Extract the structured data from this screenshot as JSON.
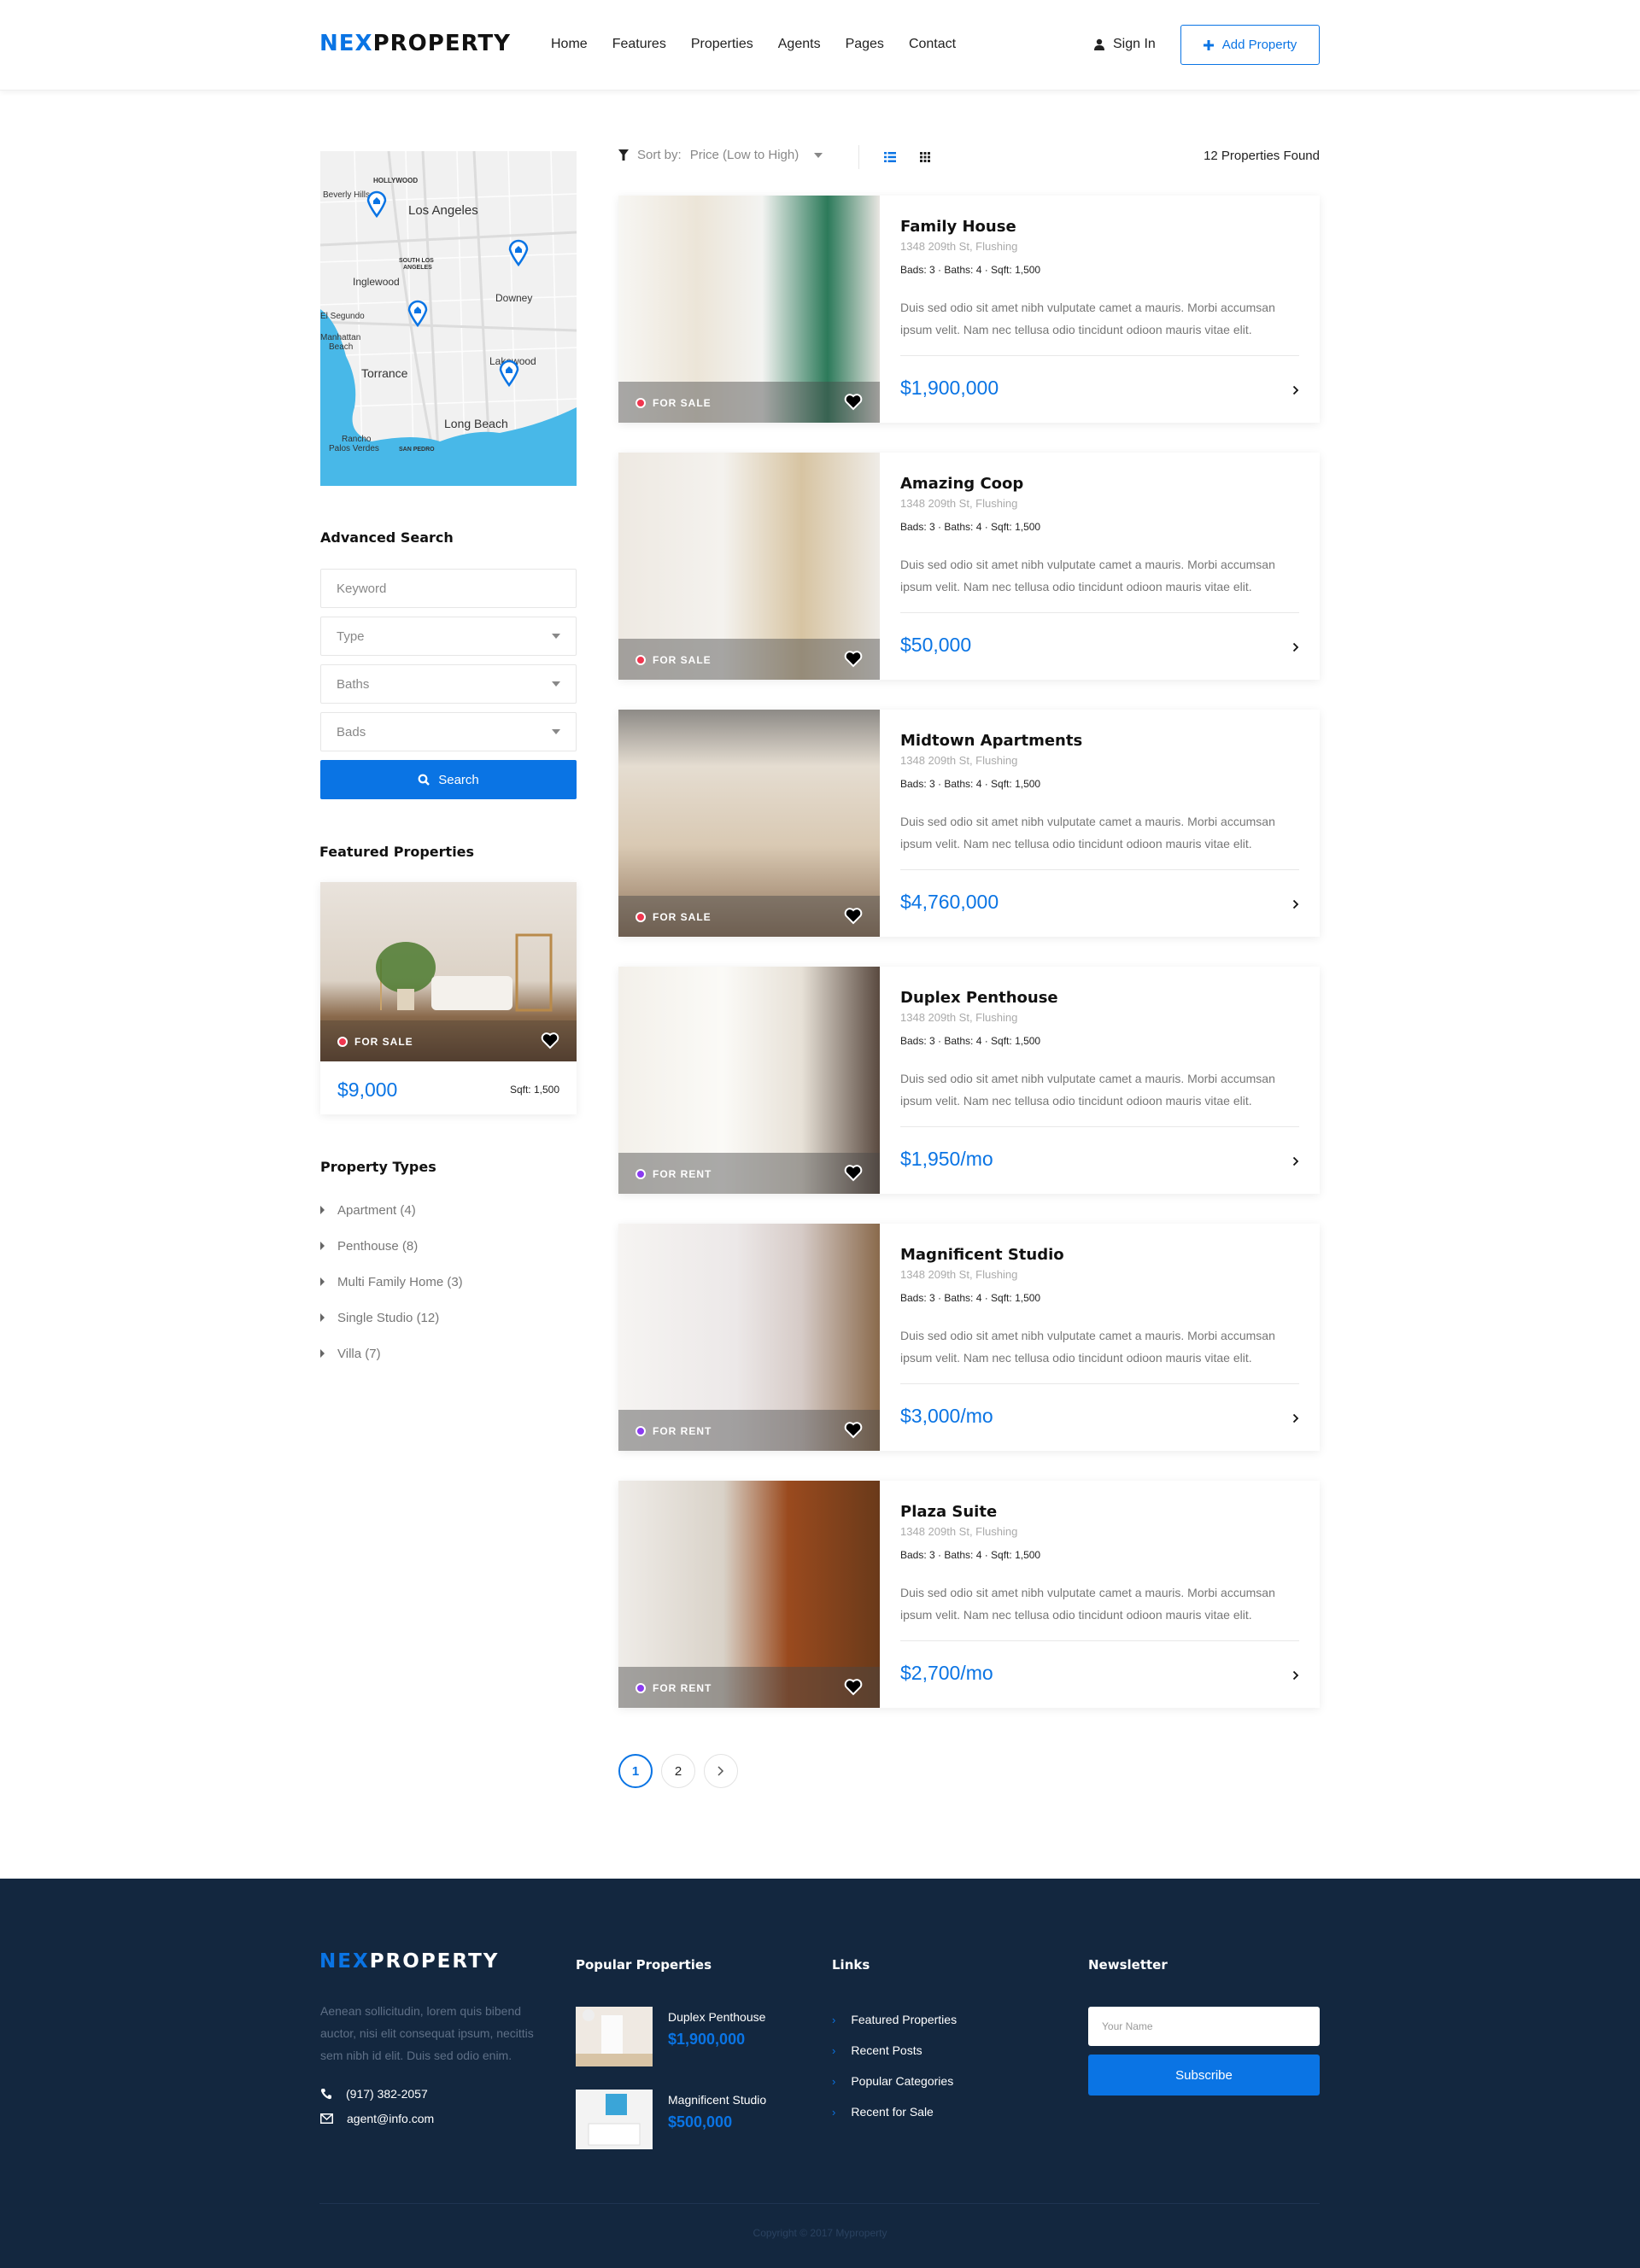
{
  "colors": {
    "accent": "#0a74e4",
    "for_sale": "#f0364f",
    "for_rent": "#8a3bf0",
    "footer_bg": "#13273f"
  },
  "header": {
    "logo_prefix": "NEX",
    "logo_suffix": "PROPERTY",
    "nav": [
      "Home",
      "Features",
      "Properties",
      "Agents",
      "Pages",
      "Contact"
    ],
    "sign_in": "Sign In",
    "add_property": "Add Property"
  },
  "map": {
    "labels": [
      "HOLLYWOOD",
      "Beverly Hills",
      "Los Angeles",
      "SOUTH LOS ANGELES",
      "Inglewood",
      "Downey",
      "El Segundo",
      "Manhattan Beach",
      "Torrance",
      "Lakewood",
      "Long Beach",
      "Rancho Palos Verdes",
      "SAN PEDRO"
    ],
    "markers": 4
  },
  "search": {
    "heading": "Advanced Search",
    "keyword_placeholder": "Keyword",
    "type_placeholder": "Type",
    "baths_placeholder": "Baths",
    "bads_placeholder": "Bads",
    "button": "Search"
  },
  "featured": {
    "heading": "Featured Properties",
    "status": "FOR SALE",
    "price": "$9,000",
    "sqft": "Sqft: 1,500"
  },
  "property_types": {
    "heading": "Property Types",
    "items": [
      "Apartment (4)",
      "Penthouse (8)",
      "Multi Family Home (3)",
      "Single Studio (12)",
      "Villa (7)"
    ]
  },
  "toolbar": {
    "sort_label": "Sort by:",
    "sort_value": "Price (Low to High)",
    "found": "12 Properties Found"
  },
  "listings": [
    {
      "title": "Family House",
      "address": "1348 209th St, Flushing",
      "meta": "Bads: 3  ·  Baths: 4  ·  Sqft: 1,500",
      "desc": "Duis sed odio sit amet nibh vulputate camet a mauris. Morbi accumsan ipsum velit. Nam nec tellusa odio tincidunt odioon  mauris vitae elit.",
      "price": "$1,900,000",
      "status": "FOR SALE",
      "kind": "sale"
    },
    {
      "title": "Amazing Coop",
      "address": "1348 209th St, Flushing",
      "meta": "Bads: 3  ·  Baths: 4  ·  Sqft: 1,500",
      "desc": "Duis sed odio sit amet nibh vulputate camet a mauris. Morbi accumsan ipsum velit. Nam nec tellusa odio tincidunt odioon  mauris vitae elit.",
      "price": "$50,000",
      "status": "FOR SALE",
      "kind": "sale"
    },
    {
      "title": "Midtown Apartments",
      "address": "1348 209th St, Flushing",
      "meta": "Bads: 3  ·  Baths: 4  ·  Sqft: 1,500",
      "desc": "Duis sed odio sit amet nibh vulputate camet a mauris. Morbi accumsan ipsum velit. Nam nec tellusa odio tincidunt odioon  mauris vitae elit.",
      "price": "$4,760,000",
      "status": "FOR SALE",
      "kind": "sale"
    },
    {
      "title": "Duplex Penthouse",
      "address": "1348 209th St, Flushing",
      "meta": "Bads: 3  ·  Baths: 4  ·  Sqft: 1,500",
      "desc": "Duis sed odio sit amet nibh vulputate camet a mauris. Morbi accumsan ipsum velit. Nam nec tellusa odio tincidunt odioon  mauris vitae elit.",
      "price": "$1,950/mo",
      "status": "FOR RENT",
      "kind": "rent"
    },
    {
      "title": "Magnificent Studio",
      "address": "1348 209th St, Flushing",
      "meta": "Bads: 3  ·  Baths: 4  ·  Sqft: 1,500",
      "desc": "Duis sed odio sit amet nibh vulputate camet a mauris. Morbi accumsan ipsum velit. Nam nec tellusa odio tincidunt odioon  mauris vitae elit.",
      "price": "$3,000/mo",
      "status": "FOR RENT",
      "kind": "rent"
    },
    {
      "title": "Plaza Suite",
      "address": "1348 209th St, Flushing",
      "meta": "Bads: 3  ·  Baths: 4  ·  Sqft: 1,500",
      "desc": "Duis sed odio sit amet nibh vulputate camet a mauris. Morbi accumsan ipsum velit. Nam nec tellusa odio tincidunt odioon  mauris vitae elit.",
      "price": "$2,700/mo",
      "status": "FOR RENT",
      "kind": "rent"
    }
  ],
  "pagination": {
    "pages": [
      "1",
      "2"
    ],
    "current": "1",
    "next": "›"
  },
  "footer": {
    "logo_prefix": "NEX",
    "logo_suffix": "PROPERTY",
    "description": "Aenean sollicitudin, lorem quis bibend auctor, nisi elit consequat ipsum, necittis sem nibh id elit. Duis sed odio enim.",
    "phone": "(917) 382-2057",
    "email": "agent@info.com",
    "popular_heading": "Popular Properties",
    "popular": [
      {
        "name": "Duplex Penthouse",
        "price": "$1,900,000"
      },
      {
        "name": "Magnificent Studio",
        "price": "$500,000"
      }
    ],
    "links_heading": "Links",
    "links": [
      "Featured Properties",
      "Recent Posts",
      "Popular Categories",
      "Recent for Sale"
    ],
    "newsletter_heading": "Newsletter",
    "newsletter_placeholder": "Your Name",
    "subscribe": "Subscribe",
    "copyright": "Copyright © 2017 Myproperty"
  }
}
